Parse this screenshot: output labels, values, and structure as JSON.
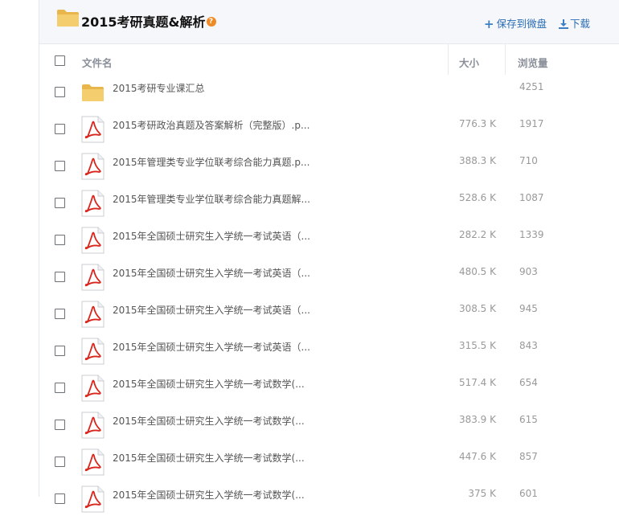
{
  "header": {
    "title": "2015考研真题&解析",
    "help_glyph": "?",
    "save_label": "保存到微盘",
    "download_label": "下载"
  },
  "columns": {
    "name": "文件名",
    "size": "大小",
    "views": "浏览量"
  },
  "colors": {
    "header_bg": "#f5f7fa",
    "link": "#2b6db3",
    "help_badge": "#f08a24",
    "pdf_red": "#d9251c",
    "folder_yellow": "#f2c867"
  },
  "files": [
    {
      "type": "folder",
      "icon": "folder-icon",
      "name": "2015考研专业课汇总",
      "size": "",
      "views": "4251"
    },
    {
      "type": "pdf",
      "icon": "pdf-icon",
      "name": "2015考研政治真题及答案解析（完整版）.p...",
      "size": "776.3 K",
      "views": "1917"
    },
    {
      "type": "pdf",
      "icon": "pdf-icon",
      "name": "2015年管理类专业学位联考综合能力真题.p...",
      "size": "388.3 K",
      "views": "710"
    },
    {
      "type": "pdf",
      "icon": "pdf-icon",
      "name": "2015年管理类专业学位联考综合能力真题解...",
      "size": "528.6 K",
      "views": "1087"
    },
    {
      "type": "pdf",
      "icon": "pdf-icon",
      "name": "2015年全国硕士研究生入学统一考试英语（...",
      "size": "282.2 K",
      "views": "1339"
    },
    {
      "type": "pdf",
      "icon": "pdf-icon",
      "name": "2015年全国硕士研究生入学统一考试英语（...",
      "size": "480.5 K",
      "views": "903"
    },
    {
      "type": "pdf",
      "icon": "pdf-icon",
      "name": "2015年全国硕士研究生入学统一考试英语（...",
      "size": "308.5 K",
      "views": "945"
    },
    {
      "type": "pdf",
      "icon": "pdf-icon",
      "name": "2015年全国硕士研究生入学统一考试英语（...",
      "size": "315.5 K",
      "views": "843"
    },
    {
      "type": "pdf",
      "icon": "pdf-icon",
      "name": "2015年全国硕士研究生入学统一考试数学(...",
      "size": "517.4 K",
      "views": "654"
    },
    {
      "type": "pdf",
      "icon": "pdf-icon",
      "name": "2015年全国硕士研究生入学统一考试数学(...",
      "size": "383.9 K",
      "views": "615"
    },
    {
      "type": "pdf",
      "icon": "pdf-icon",
      "name": "2015年全国硕士研究生入学统一考试数学(...",
      "size": "447.6 K",
      "views": "857"
    },
    {
      "type": "pdf",
      "icon": "pdf-icon",
      "name": "2015年全国硕士研究生入学统一考试数学(...",
      "size": "375 K",
      "views": "601"
    }
  ]
}
